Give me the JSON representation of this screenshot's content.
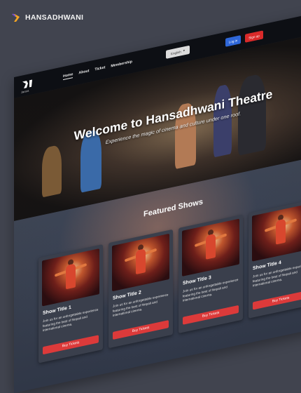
{
  "brand": {
    "name": "HANSADHWANI"
  },
  "nav": {
    "logo_sub": "Jarara",
    "links": [
      "Home",
      "About",
      "Ticket",
      "Membership"
    ],
    "language": "English",
    "login": "Log in",
    "signup": "Sign up"
  },
  "hero": {
    "title": "Welcome to Hansadhwani Theatre",
    "subtitle": "Experience the magic of cinema and culture under one roof."
  },
  "featured": {
    "title": "Featured Shows",
    "shows": [
      {
        "title": "Show Title 1",
        "description": "Join us for an unforgettable experience featuring the best of Nepali and international cinema.",
        "button": "Buy Tickets"
      },
      {
        "title": "Show Title 2",
        "description": "Join us for an unforgettable experience featuring the best of Nepali and international cinema.",
        "button": "Buy Tickets"
      },
      {
        "title": "Show Title 3",
        "description": "Join us for an unforgettable experience featuring the best of Nepali and international cinema.",
        "button": "Buy Tickets"
      },
      {
        "title": "Show Title 4",
        "description": "Join us for an unforgettable experience featuring the best of Nepali and international cinema.",
        "button": "Buy Tickets"
      }
    ]
  },
  "colors": {
    "background": "#41444f",
    "accent_blue": "#2f67d8",
    "accent_red": "#d92a2a"
  }
}
